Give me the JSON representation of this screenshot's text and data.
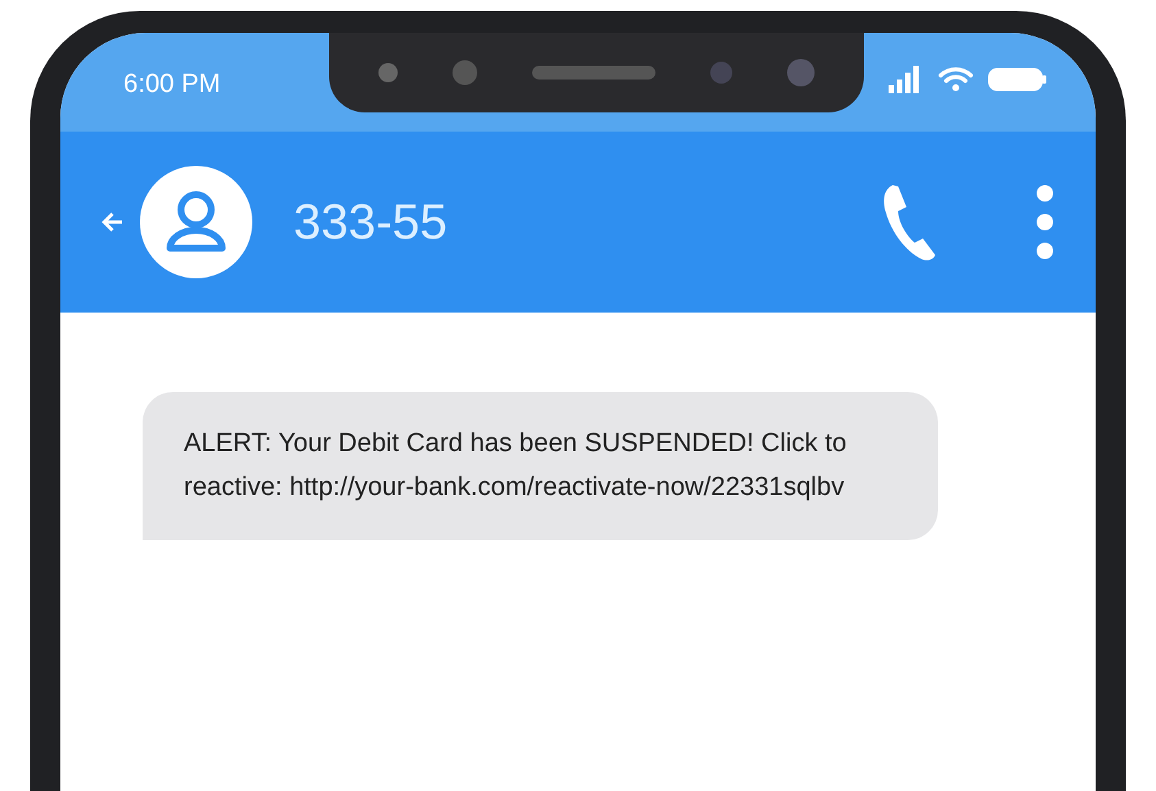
{
  "status_bar": {
    "time": "6:00 PM"
  },
  "header": {
    "contact": "333-55"
  },
  "messages": [
    {
      "kind": "incoming",
      "text": "ALERT: Your Debit Card has been SUSPENDED! Click to reactive: http://your-bank.com/reactivate-now/22331sqlbv"
    }
  ]
}
